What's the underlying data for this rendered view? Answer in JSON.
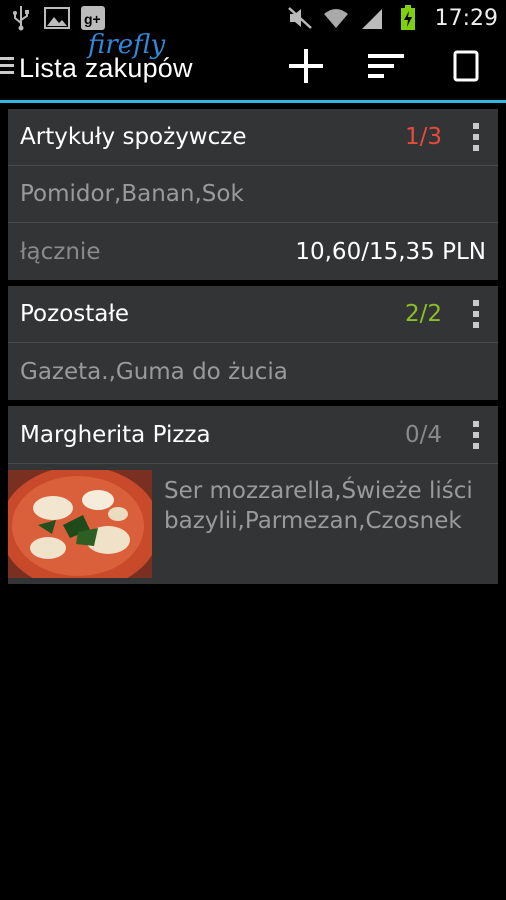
{
  "status_bar": {
    "time": "17:29",
    "left_icons": [
      "usb-icon",
      "image-icon",
      "google-plus-icon"
    ],
    "right_icons": [
      "mute-icon",
      "wifi-icon",
      "signal-icon",
      "battery-charging-icon"
    ],
    "battery_color": "#80d010"
  },
  "action_bar": {
    "title": "Lista zakupów",
    "logo_text": "firefly",
    "actions": [
      "add-icon",
      "sort-icon",
      "select-icon"
    ],
    "accent_color": "#33b5e5"
  },
  "lists": [
    {
      "title": "Artykuły spożywcze",
      "count": "1/3",
      "count_color": "#e84b3c",
      "items": "Pomidor,Banan,Sok",
      "total_label": "łącznie",
      "total_value": "10,60/15,35 PLN"
    },
    {
      "title": "Pozostałe",
      "count": "2/2",
      "count_color": "#8cbf26",
      "items": "Gazeta.,Guma do żucia"
    },
    {
      "title": "Margherita Pizza",
      "count": "0/4",
      "count_color": "#8a8a8a",
      "items": "Ser mozzarella,Świeże liści bazylii,Parmezan,Czosnek",
      "image": "pizza-photo"
    }
  ]
}
